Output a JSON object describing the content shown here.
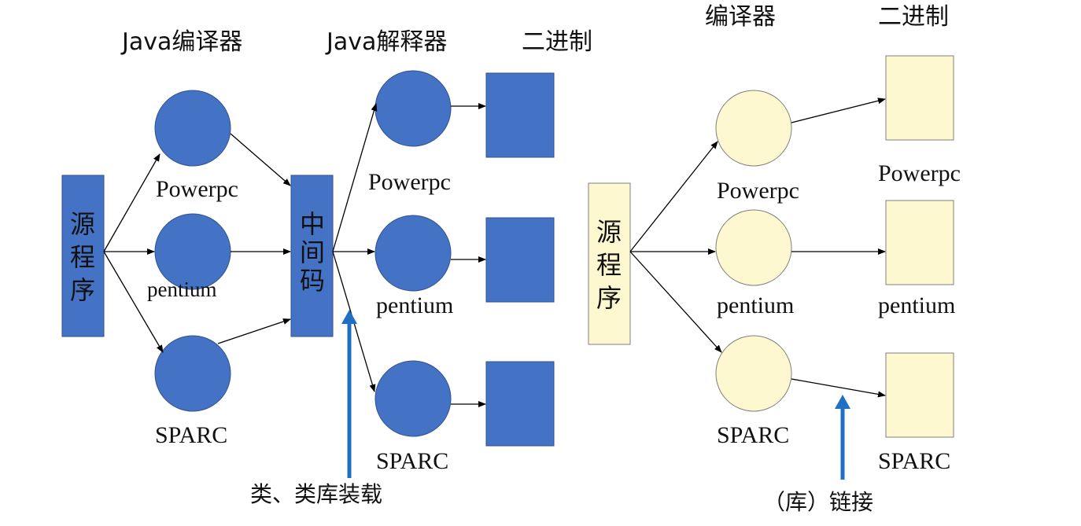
{
  "left_diagram": {
    "header_compiler": "Java编译器",
    "header_interpreter": "Java解释器",
    "header_binary": "二进制",
    "source_box": [
      "源",
      "程",
      "序"
    ],
    "intermediate_box": [
      "中",
      "间",
      "码"
    ],
    "compiler_labels": [
      "Powerpc",
      "pentium",
      "SPARC"
    ],
    "interpreter_labels": [
      "Powerpc",
      "pentium",
      "SPARC"
    ],
    "note": "类、类库装载",
    "colors": {
      "node_fill": "#4472c4",
      "arrow_pointer": "#1f6fc5"
    }
  },
  "right_diagram": {
    "header_compiler": "编译器",
    "header_binary": "二进制",
    "source_box": [
      "源",
      "程",
      "序"
    ],
    "compiler_labels": [
      "Powerpc",
      "pentium",
      "SPARC"
    ],
    "binary_labels": [
      "Powerpc",
      "pentium",
      "SPARC"
    ],
    "note": "（库）链接",
    "colors": {
      "node_fill": "#fdf8cf",
      "arrow_pointer": "#1f6fc5"
    }
  }
}
